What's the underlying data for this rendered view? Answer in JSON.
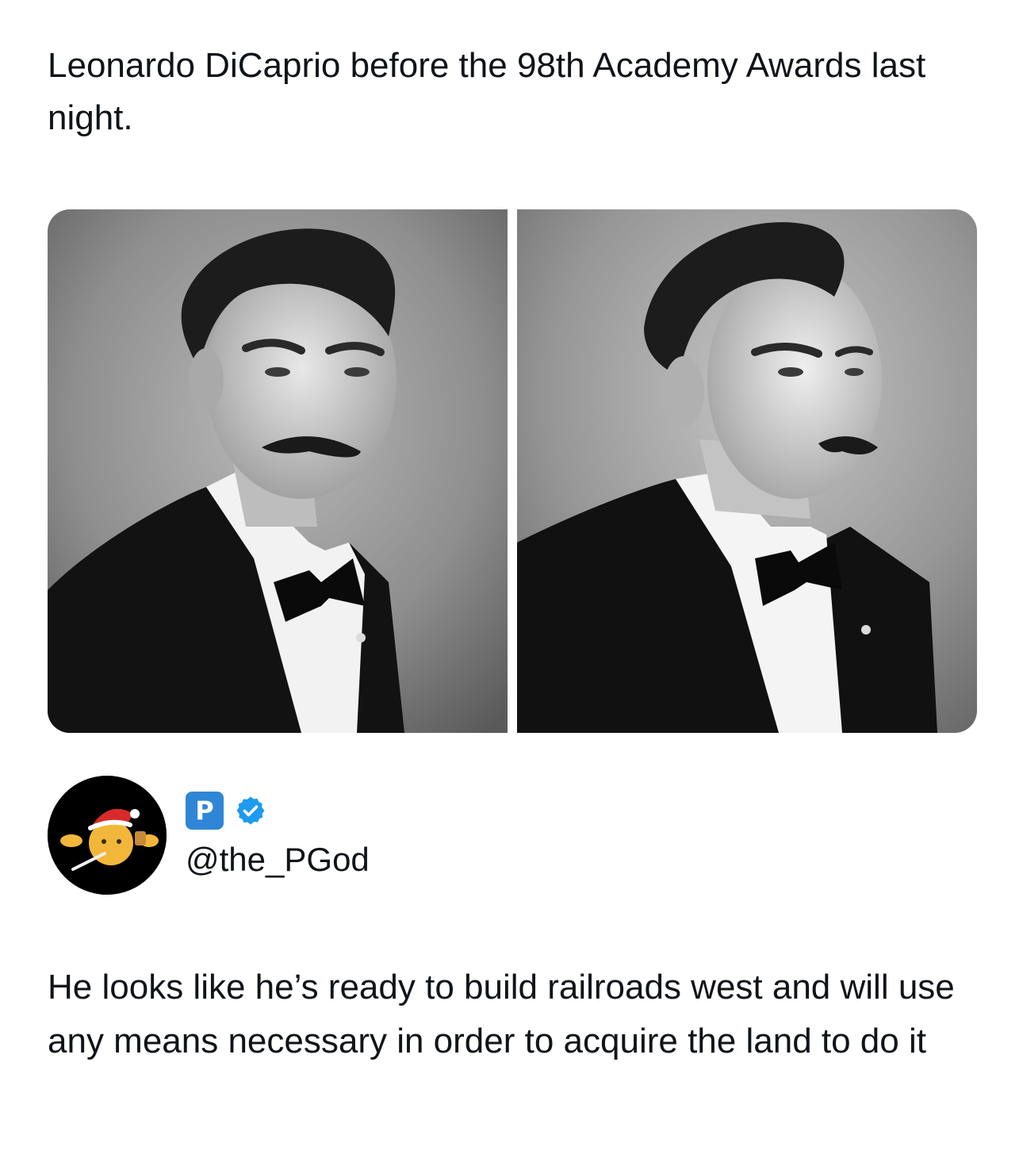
{
  "post": {
    "text": "Leonardo DiCaprio before the 98th Academy Awards last night."
  },
  "media": {
    "photos": [
      {
        "subject": "black-and-white portrait, facing camera"
      },
      {
        "subject": "black-and-white portrait, three-quarter profile"
      }
    ]
  },
  "quote": {
    "display_badge": "P",
    "handle": "@the_PGod",
    "verified": true,
    "badge_color": "#2f86d6",
    "text": "He looks like he’s ready to build railroads west and will use any means necessary in order to acquire the land to do it"
  }
}
